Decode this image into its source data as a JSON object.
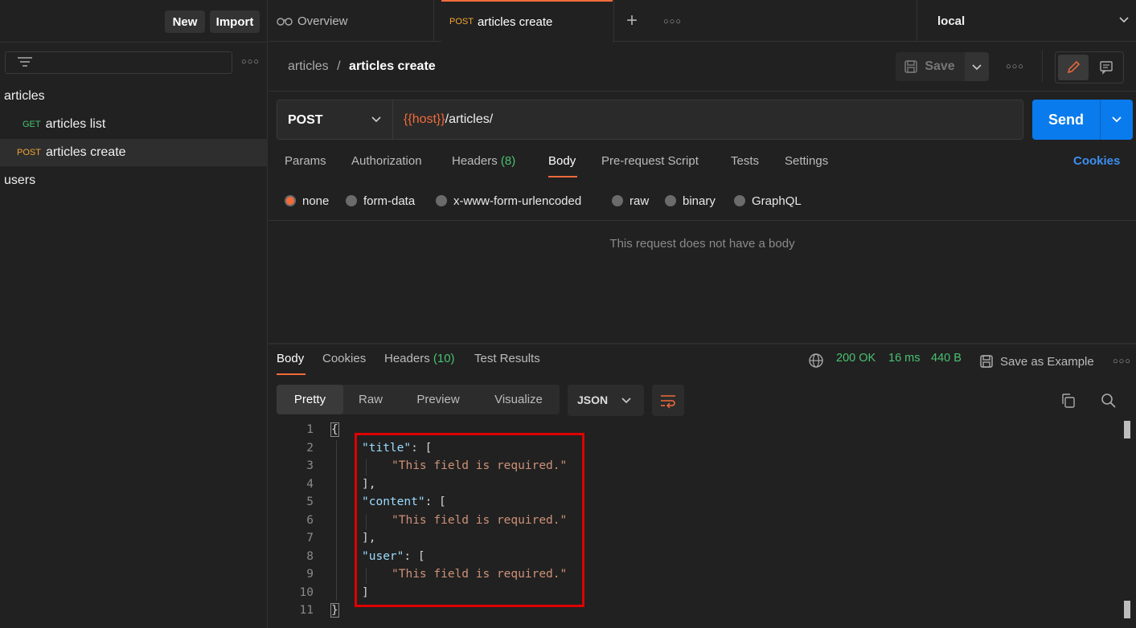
{
  "sidebar": {
    "new_label": "New",
    "import_label": "Import",
    "filter_placeholder": "",
    "more": "○○○",
    "items": [
      {
        "label": "articles"
      },
      {
        "method": "GET",
        "label": "articles list"
      },
      {
        "method": "POST",
        "label": "articles create"
      },
      {
        "label": "users"
      }
    ]
  },
  "tabs": {
    "overview": "Overview",
    "active_method": "POST",
    "active_label": "articles create",
    "add": "+",
    "more": "○○○",
    "environment": "local"
  },
  "header": {
    "breadcrumb_parent": "articles",
    "breadcrumb_sep": "/",
    "breadcrumb_current": "articles create",
    "save_label": "Save",
    "more": "○○○"
  },
  "request": {
    "method": "POST",
    "url_var": "{{host}}",
    "url_path": "/articles/",
    "send_label": "Send"
  },
  "req_tabs": {
    "params": "Params",
    "authorization": "Authorization",
    "headers": "Headers",
    "headers_count": "(8)",
    "body": "Body",
    "prerequest": "Pre-request Script",
    "tests": "Tests",
    "settings": "Settings",
    "cookies": "Cookies"
  },
  "body_types": [
    "none",
    "form-data",
    "x-www-form-urlencoded",
    "raw",
    "binary",
    "GraphQL"
  ],
  "body_empty_text": "This request does not have a body",
  "response": {
    "tab_body": "Body",
    "tab_cookies": "Cookies",
    "tab_headers": "Headers",
    "tab_headers_count": "(10)",
    "tab_tests": "Test Results",
    "status": "200 OK",
    "time": "16 ms",
    "size": "440 B",
    "save_example": "Save as Example",
    "more": "○○○",
    "views": [
      "Pretty",
      "Raw",
      "Preview",
      "Visualize"
    ],
    "format": "JSON",
    "lines": [
      "1",
      "2",
      "3",
      "4",
      "5",
      "6",
      "7",
      "8",
      "9",
      "10",
      "11"
    ],
    "code": {
      "l1": "{",
      "k_title": "\"title\"",
      "k_content": "\"content\"",
      "k_user": "\"user\"",
      "colon_open": ": [",
      "msg": "\"This field is required.\"",
      "close_comma": "],",
      "close": "]",
      "l11": "}"
    }
  },
  "colors": {
    "accent_orange": "#f26b3a",
    "send_blue": "#097bed",
    "status_green": "#49c170",
    "highlight_red": "#e00000"
  }
}
